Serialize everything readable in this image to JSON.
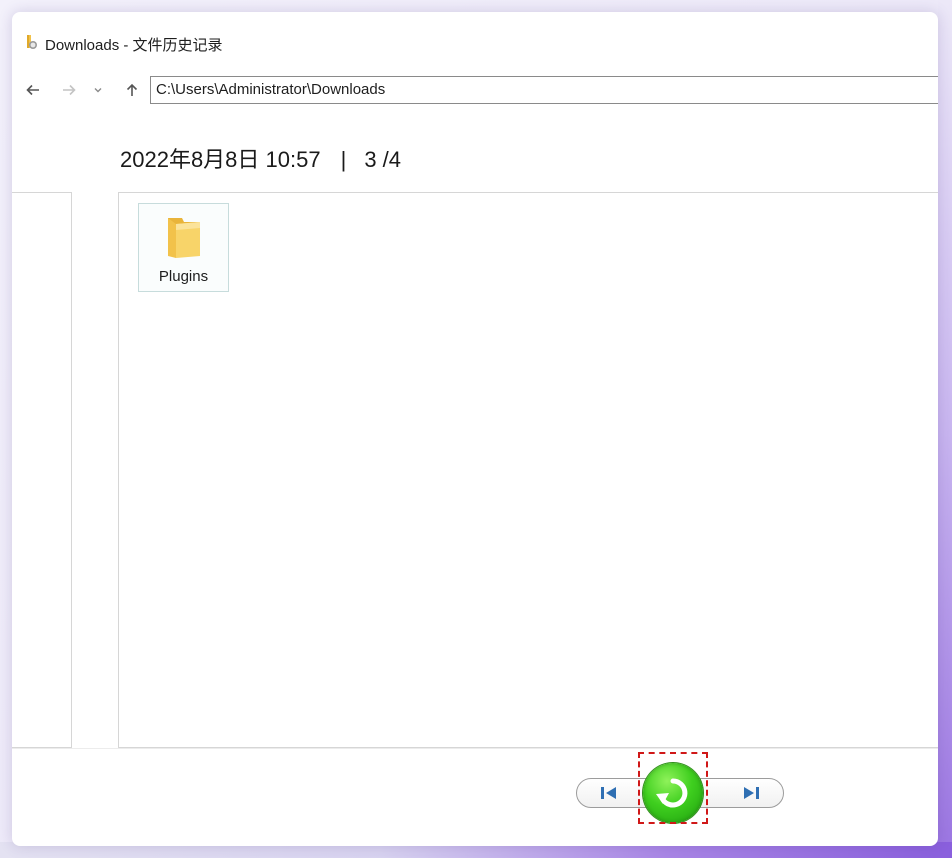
{
  "window": {
    "title": "Downloads - 文件历史记录"
  },
  "nav": {
    "back_icon": "arrow-left-icon",
    "forward_icon": "arrow-right-icon",
    "recent_icon": "chevron-down-icon",
    "up_icon": "arrow-up-icon",
    "address": "C:\\Users\\Administrator\\Downloads"
  },
  "snapshot": {
    "datetime": "2022年8月8日 10:57",
    "separator": "|",
    "position": "3 /4"
  },
  "files": [
    {
      "name": "Plugins",
      "icon": "folder-icon"
    }
  ],
  "controls": {
    "previous_icon": "skip-previous-icon",
    "restore_icon": "restore-icon",
    "next_icon": "skip-next-icon"
  },
  "colors": {
    "restore_green": "#3fcf1f",
    "nav_blue": "#2f6fb3",
    "highlight_red": "#d01818",
    "folder_yellow": "#f6cc55"
  }
}
